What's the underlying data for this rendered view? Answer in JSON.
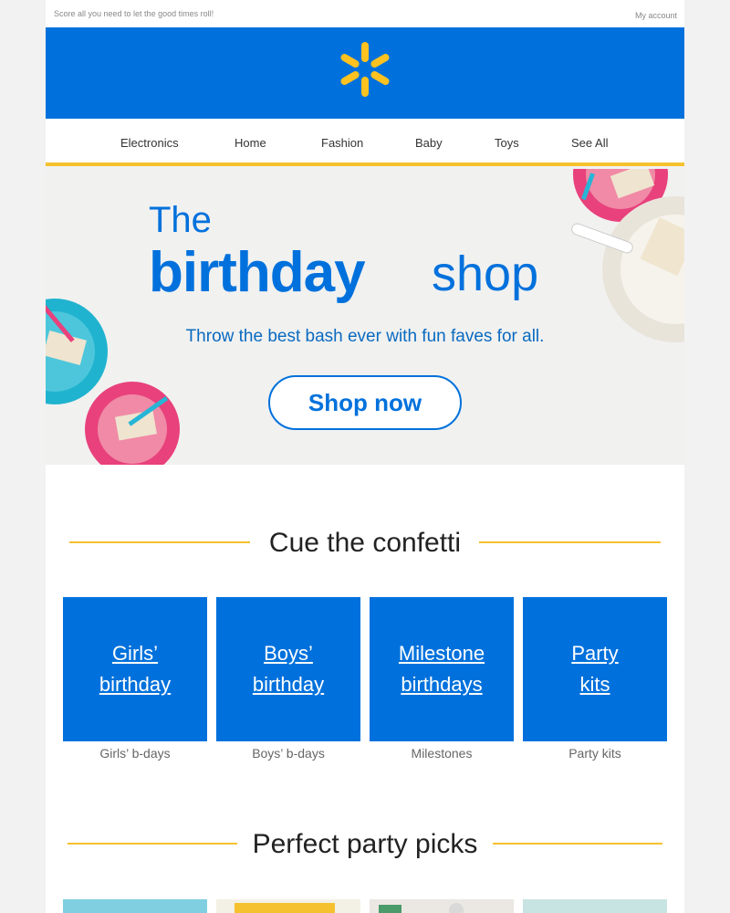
{
  "topbar": {
    "preheader": "Score all you need to let the good times roll!",
    "account_link": "My account"
  },
  "header": {
    "logo_icon": "walmart-spark-icon",
    "brand_color": "#0071dc",
    "logo_color": "#ffc220"
  },
  "nav": {
    "items": [
      "Electronics",
      "Home",
      "Fashion",
      "Baby",
      "Toys",
      "See All"
    ],
    "underline_color": "#f5c12e"
  },
  "hero": {
    "the": "The",
    "birthday": "birthday",
    "shop": "shop",
    "subtitle": "Throw the best bash ever with fun faves for all.",
    "cta": "Shop now"
  },
  "confetti": {
    "title": "Cue the confetti",
    "tiles": [
      {
        "line1": "Girls’",
        "line2": "birthday",
        "caption": "Girls’ b-days"
      },
      {
        "line1": "Boys’",
        "line2": "birthday",
        "caption": "Boys’ b-days"
      },
      {
        "line1": "Milestone",
        "line2": "birthdays",
        "caption": "Milestones"
      },
      {
        "line1": "Party",
        "line2": "kits",
        "caption": "Party kits"
      }
    ]
  },
  "party_picks": {
    "title": "Perfect party picks"
  }
}
